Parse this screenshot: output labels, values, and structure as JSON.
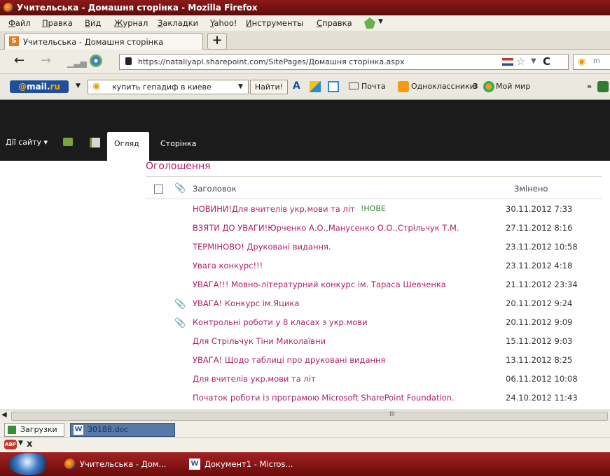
{
  "window": {
    "title": "Учительська - Домашня сторінка - Mozilla Firefox"
  },
  "menu": [
    "Файл",
    "Правка",
    "Вид",
    "Журнал",
    "Закладки",
    "Yahoo!",
    "Инструменты",
    "Справка"
  ],
  "tab": {
    "label": "Учительська - Домашня сторінка",
    "new_tab": "+"
  },
  "nav": {
    "url": "https://nataliyapl.sharepoint.com/SitePages/Домашня сторінка.aspx",
    "reload": "C",
    "search_engine_glyph": "m"
  },
  "mailru": {
    "logo_at": "@",
    "logo_mail": "mail",
    "logo_ru": "ru",
    "search_value": "купить гепадиф в киеве",
    "find_label": "Найти!",
    "font_label": "A",
    "mail_label": "Почта",
    "ok_label": "Одноклассники",
    "ok_count": "3",
    "myworld_label": "Мой мир",
    "more": "»"
  },
  "sharepoint": {
    "site_actions": "Дії сайту ▾",
    "tab_browse": "Огляд",
    "tab_page": "Сторінка"
  },
  "list": {
    "title": "Оголошення",
    "col_title": "Заголовок",
    "col_modified": "Змінено",
    "rows": [
      {
        "title": "НОВИНИ!Для вчителів укр.мови та літ",
        "badge": "!НОВЕ",
        "attach": false,
        "modified": "30.11.2012 7:33"
      },
      {
        "title": "ВЗЯТИ ДО УВАГИ!Юрченко А.О.,Манусенко О.О.,Стрільчук Т.М.",
        "badge": "",
        "attach": false,
        "modified": "27.11.2012 8:16"
      },
      {
        "title": "ТЕРМІНОВО! Друковані видання.",
        "badge": "",
        "attach": false,
        "modified": "23.11.2012 10:58"
      },
      {
        "title": "Увага конкурс!!!",
        "badge": "",
        "attach": false,
        "modified": "23.11.2012 4:18"
      },
      {
        "title": "УВАГА!!! Мовно-літературний конкурс ім. Тараса Шевченка",
        "badge": "",
        "attach": false,
        "modified": "21.11.2012 23:34"
      },
      {
        "title": "УВАГА! Конкурс ім.Яцика",
        "badge": "",
        "attach": true,
        "modified": "20.11.2012 9:24"
      },
      {
        "title": "Контрольні роботи у 8 класах з укр.мови",
        "badge": "",
        "attach": true,
        "modified": "20.11.2012 9:09"
      },
      {
        "title": "Для Стрільчук Тіни Миколаївни",
        "badge": "",
        "attach": false,
        "modified": "15.11.2012 9:03"
      },
      {
        "title": "УВАГА! Щодо таблиці про друковані видання",
        "badge": "",
        "attach": false,
        "modified": "13.11.2012 8:25"
      },
      {
        "title": "Для вчителів укр.мови та літ",
        "badge": "",
        "attach": false,
        "modified": "06.11.2012 10:08"
      },
      {
        "title": "Початок роботи із програмою Microsoft SharePoint Foundation.",
        "badge": "",
        "attach": false,
        "modified": "24.10.2012 11:43"
      }
    ]
  },
  "scrollbar": {
    "grip": "III"
  },
  "downloads": {
    "label": "Загрузки",
    "file": "30188.doc"
  },
  "addonbar": {
    "abp": "ABP",
    "close": "x"
  },
  "taskbar": {
    "items": [
      {
        "label": "Учительська - Дом..."
      },
      {
        "label": "Документ1 - Micros..."
      }
    ]
  },
  "colors": {
    "accent_title": "#b02064",
    "new_badge": "#2e7d32",
    "titlebar": "#7a1414"
  }
}
